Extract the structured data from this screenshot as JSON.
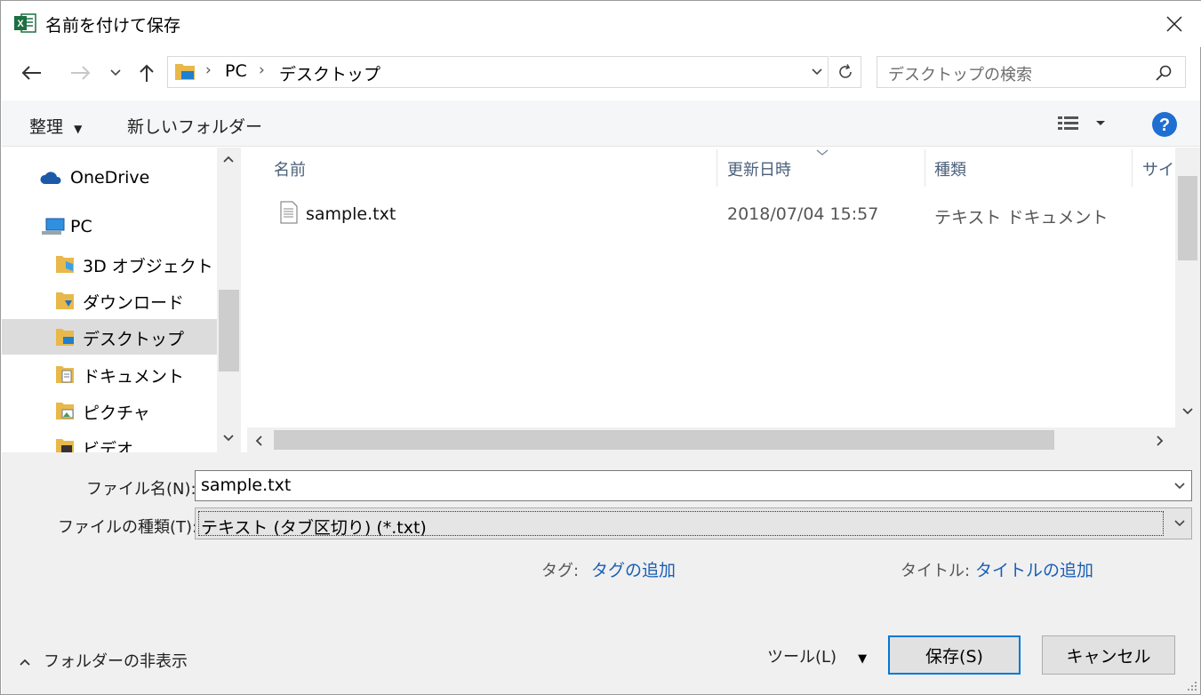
{
  "window": {
    "title": "名前を付けて保存",
    "app_icon": "excel-icon"
  },
  "nav": {
    "breadcrumb": [
      "PC",
      "デスクトップ"
    ],
    "search_placeholder": "デスクトップの検索"
  },
  "toolbar": {
    "organize_label": "整理",
    "new_folder_label": "新しいフォルダー"
  },
  "sidebar": {
    "items": [
      {
        "label": "OneDrive",
        "icon": "onedrive-icon"
      },
      {
        "label": "PC",
        "icon": "pc-icon"
      },
      {
        "label": "3D オブジェクト",
        "icon": "3d-objects-folder-icon"
      },
      {
        "label": "ダウンロード",
        "icon": "downloads-folder-icon"
      },
      {
        "label": "デスクトップ",
        "icon": "desktop-folder-icon",
        "selected": true
      },
      {
        "label": "ドキュメント",
        "icon": "documents-folder-icon"
      },
      {
        "label": "ピクチャ",
        "icon": "pictures-folder-icon"
      },
      {
        "label": "ビデオ",
        "icon": "videos-folder-icon"
      }
    ]
  },
  "file_list": {
    "columns": [
      "名前",
      "更新日時",
      "種類",
      "サイズ"
    ],
    "rows": [
      {
        "name": "sample.txt",
        "modified": "2018/07/04 15:57",
        "type": "テキスト ドキュメント"
      }
    ]
  },
  "form": {
    "filename_label": "ファイル名(N):",
    "filename_value": "sample.txt",
    "filetype_label": "ファイルの種類(T):",
    "filetype_value": "テキスト (タブ区切り) (*.txt)",
    "tags_label": "タグ:",
    "tags_link": "タグの追加",
    "title_label": "タイトル:",
    "title_link": "タイトルの追加"
  },
  "footer": {
    "hide_folders_label": "フォルダーの非表示",
    "tools_label": "ツール(L)",
    "save_label": "保存(S)",
    "cancel_label": "キャンセル"
  },
  "colors": {
    "accent": "#0078d7",
    "link": "#1a5fb4",
    "help_icon": "#1e6fd1",
    "excel_green": "#1d6f42"
  }
}
